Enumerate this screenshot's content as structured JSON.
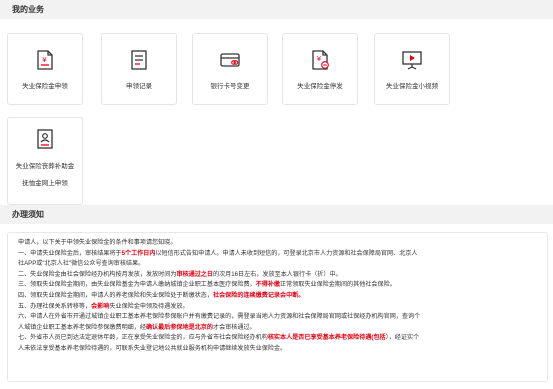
{
  "sections": {
    "business_title": "我的业务",
    "notice_title": "办理须知"
  },
  "tiles": [
    {
      "label": "失业保险金申领",
      "icon": "yuan-document-icon"
    },
    {
      "label": "申领记录",
      "icon": "record-list-icon"
    },
    {
      "label": "银行卡号变更",
      "icon": "bank-card-icon"
    },
    {
      "label": "失业保险金停发",
      "icon": "yuan-document-stop-icon"
    },
    {
      "label": "失业保险金小视频",
      "icon": "video-board-icon"
    },
    {
      "label_line1": "失业保险丧葬补助金",
      "label_line2": "抚恤金网上申领",
      "icon": "person-document-icon"
    }
  ],
  "notice": {
    "intro": "申请人，以下关于申领失业保险金的条件和事项请您知晓。",
    "items": [
      {
        "pre": "一、申请失业保险金后，审核结果将于",
        "hl": "5个工作日内",
        "post": "以短信形式告知申请人。申请人未收到短信的，可登录北京市人力资源和社会保障局官网、北京人"
      },
      {
        "pre": "社APP或\"北京人社\"微信公众号查询审核结果。",
        "hl": "",
        "post": ""
      },
      {
        "pre": "二、失业保险金由社会保险经办机构按月发放，发放时间为",
        "hl": "审核通过之日",
        "post": "的次月16日左右，发放至本人银行卡（折）中。"
      },
      {
        "pre": "三、领取失业保险金期间，由失业保险基金为申请人缴纳城镇企业职工基本医疗保险费，",
        "hl": "不得补缴",
        "post": "正常领取失业保险金期间的其他社会保险。"
      },
      {
        "pre": "四、领取失业保险金期间，申请人的养老保险和失业保险处于断缴状态，",
        "hl": "社会保险的连续缴费记录会中断。",
        "post": ""
      },
      {
        "pre": "五、办理社保关系转移等，",
        "hl": "会影响",
        "post": "失业保险金申领及待遇发放。"
      },
      {
        "pre": "六、申请人在外省市开通过城镇企业职工基本养老保险参保账户并有缴费记录的，需登录当地人力资源和社会保障局官网或社保经办机构官网，查询个",
        "hl": "",
        "post": ""
      },
      {
        "pre": "人城镇企业职工基本养老保险参保缴费明细，经",
        "hl": "确认最后参保地是北京的",
        "post": "才会审核通过。"
      },
      {
        "pre": "七、外省市人员已到达法定退休年龄，正在享受失业保险金的，应与外省市社会保险经办机构",
        "hl": "核实本人是否已享受基本养老保险待遇(包括",
        "post": "），经证实个"
      },
      {
        "pre": "人未依法享受基本养老保险待遇的，可联系失业登记地公共就业服务机构申请继续发放失业保险金。",
        "hl": "",
        "post": ""
      }
    ]
  }
}
